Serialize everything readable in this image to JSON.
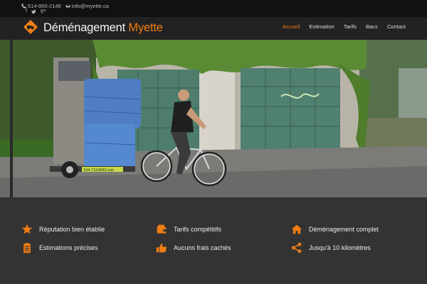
{
  "topbar": {
    "phone": "514-800-2149",
    "email": "info@myette.ca",
    "social": [
      {
        "icon": "facebook-icon",
        "glyph": "f"
      },
      {
        "icon": "twitter-icon",
        "glyph": "🐦"
      },
      {
        "icon": "google-plus-icon",
        "glyph": "g+"
      }
    ]
  },
  "header": {
    "brand_main": "Déménagement",
    "brand_accent": "Myette",
    "nav": [
      "Accueil",
      "Estimation",
      "Tarifs",
      "Bacs",
      "Contact"
    ],
    "active_nav": "Accueil"
  },
  "hero": {
    "trailer_phone": "514-713-6652.com"
  },
  "features": [
    {
      "icon": "star-icon",
      "label": "Réputation bien établie"
    },
    {
      "icon": "wallet-icon",
      "label": "Tarifs compétitifs"
    },
    {
      "icon": "home-icon",
      "label": "Déménagement complet"
    },
    {
      "icon": "clipboard-icon",
      "label": "Estimations précises"
    },
    {
      "icon": "thumbs-up-icon",
      "label": "Aucuns frais cachés"
    },
    {
      "icon": "share-icon",
      "label": "Jusqu'à 10 kilomètres"
    }
  ],
  "colors": {
    "accent": "#f07d14",
    "topbar": "#111111",
    "navbar": "#222222",
    "features_bg": "#333333"
  }
}
